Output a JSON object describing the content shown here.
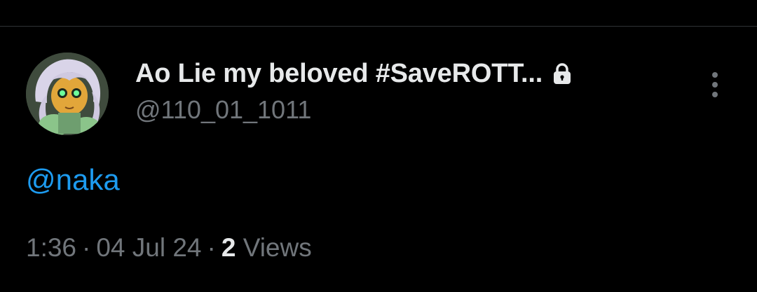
{
  "tweet": {
    "author": {
      "display_name": "Ao Lie my beloved #SaveROTT...",
      "handle": "@110_01_1011",
      "protected_icon": "lock-icon",
      "avatar_icon": "avatar-image"
    },
    "more_icon": "more-vertical-icon",
    "text": {
      "mention": "@naka"
    },
    "meta": {
      "time": "1:36",
      "separator": "·",
      "date": "04 Jul 24",
      "views_count": "2",
      "views_label": "Views"
    }
  },
  "colors": {
    "background": "#000000",
    "primary_text": "#e7e9ea",
    "secondary_text": "#71767b",
    "link": "#1d9bf0",
    "divider": "#2f3336"
  }
}
